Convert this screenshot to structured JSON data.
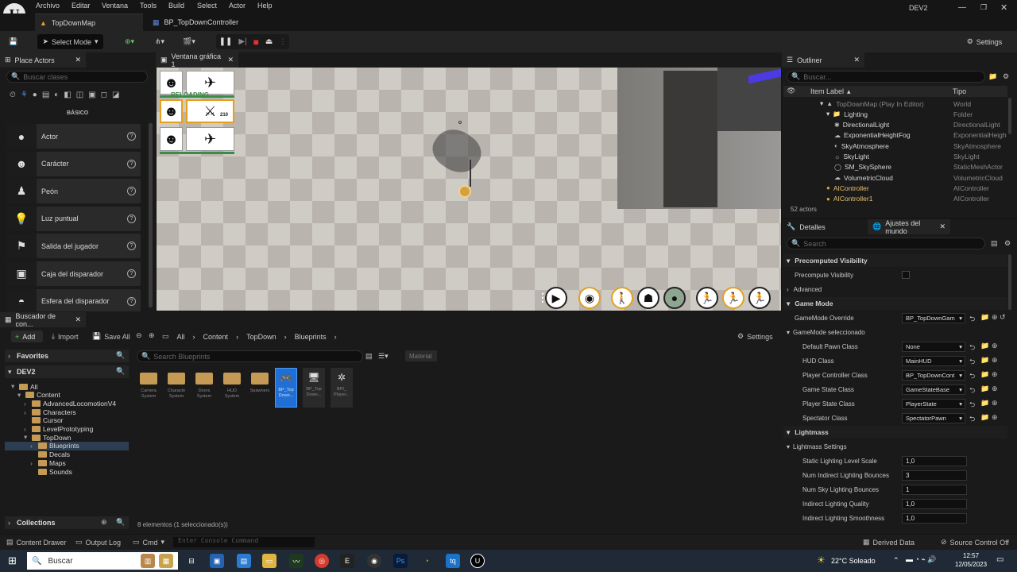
{
  "menubar": {
    "items": [
      "Archivo",
      "Editar",
      "Ventana",
      "Tools",
      "Build",
      "Select",
      "Actor",
      "Help"
    ],
    "project": "DEV2"
  },
  "tabs": {
    "level": "TopDownMap",
    "blueprint": "BP_TopDownController"
  },
  "toolbar": {
    "select_mode": "Select Mode",
    "settings": "Settings"
  },
  "place_actors": {
    "title": "Place Actors",
    "search_placeholder": "Buscar clases",
    "category": "BÁSICO",
    "items": [
      {
        "label": "Actor",
        "icon": "sphere-icon"
      },
      {
        "label": "Carácter",
        "icon": "character-icon"
      },
      {
        "label": "Peón",
        "icon": "pawn-icon"
      },
      {
        "label": "Luz puntual",
        "icon": "bulb-icon"
      },
      {
        "label": "Salida del jugador",
        "icon": "flag-icon"
      },
      {
        "label": "Caja del disparador",
        "icon": "cube-icon"
      },
      {
        "label": "Esfera del disparador",
        "icon": "dome-icon"
      }
    ]
  },
  "viewport": {
    "tab": "Ventana gráfica 1",
    "reloading": "RELOADING",
    "ammo": "210"
  },
  "outliner": {
    "title": "Outliner",
    "search_placeholder": "Buscar...",
    "col_label": "Item Label",
    "col_type": "Tipo",
    "rows": [
      {
        "label": "TopDownMap (Play In Editor)",
        "type": "World"
      },
      {
        "label": "Lighting",
        "type": "Folder"
      },
      {
        "label": "DirectionalLight",
        "type": "DirectionalLight"
      },
      {
        "label": "ExponentialHeightFog",
        "type": "ExponentialHeigh"
      },
      {
        "label": "SkyAtmosphere",
        "type": "SkyAtmosphere"
      },
      {
        "label": "SkyLight",
        "type": "SkyLight"
      },
      {
        "label": "SM_SkySphere",
        "type": "StaticMeshActor"
      },
      {
        "label": "VolumetricCloud",
        "type": "VolumetricCloud"
      },
      {
        "label": "AIController",
        "type": "AIController"
      },
      {
        "label": "AIController1",
        "type": "AIController"
      }
    ],
    "count": "52 actors"
  },
  "details": {
    "tab1": "Detalles",
    "tab2": "Ajustes del mundo",
    "search_placeholder": "Search",
    "precomputed": "Precomputed Visibility",
    "precompute_vis": "Precompute Visibility",
    "advanced": "Advanced",
    "game_mode": "Game Mode",
    "gamemode_override": "GameMode Override",
    "gamemode_override_val": "BP_TopDownGam",
    "gamemode_selected": "GameMode seleccionado",
    "gm_rows": [
      {
        "label": "Default Pawn Class",
        "value": "None"
      },
      {
        "label": "HUD Class",
        "value": "MainHUD"
      },
      {
        "label": "Player Controller Class",
        "value": "BP_TopDownCont"
      },
      {
        "label": "Game State Class",
        "value": "GameStateBase"
      },
      {
        "label": "Player State Class",
        "value": "PlayerState"
      },
      {
        "label": "Spectator Class",
        "value": "SpectatorPawn"
      }
    ],
    "lightmass": "Lightmass",
    "lightmass_settings": "Lightmass Settings",
    "lm_rows": [
      {
        "label": "Static Lighting Level Scale",
        "value": "1,0"
      },
      {
        "label": "Num Indirect Lighting Bounces",
        "value": "3"
      },
      {
        "label": "Num Sky Lighting Bounces",
        "value": "1"
      },
      {
        "label": "Indirect Lighting Quality",
        "value": "1,0"
      },
      {
        "label": "Indirect Lighting Smoothness",
        "value": "1,0"
      }
    ]
  },
  "content_browser": {
    "tab": "Buscador de con...",
    "add": "Add",
    "import": "Import",
    "save_all": "Save All",
    "settings": "Settings",
    "breadcrumb": [
      "All",
      "Content",
      "TopDown",
      "Blueprints"
    ],
    "favorites": "Favorites",
    "project": "DEV2",
    "tree": [
      "All",
      "Content",
      "AdvancedLocomotionV4",
      "Characters",
      "Cursor",
      "LevelPrototyping",
      "TopDown",
      "Blueprints",
      "Decals",
      "Maps",
      "Sounds"
    ],
    "collections": "Collections",
    "search_placeholder": "Search Blueprints",
    "filter_chip": "Material",
    "assets": [
      {
        "label": "Camera System"
      },
      {
        "label": "Characte System"
      },
      {
        "label": "Doors System"
      },
      {
        "label": "HUD System"
      },
      {
        "label": "Spawners"
      },
      {
        "label": "BP_Top Down..."
      },
      {
        "label": "BP_Top Down..."
      },
      {
        "label": "BPI_ Player..."
      }
    ],
    "status": "8 elementos (1 seleccionado(s))"
  },
  "bottombar": {
    "content_drawer": "Content Drawer",
    "output_log": "Output Log",
    "cmd": "Cmd",
    "console_placeholder": "Enter Console Command",
    "derived_data": "Derived Data",
    "source_control": "Source Control Off"
  },
  "taskbar": {
    "search": "Buscar",
    "weather": "22°C  Soleado",
    "time": "12:57",
    "date": "12/05/2023"
  }
}
